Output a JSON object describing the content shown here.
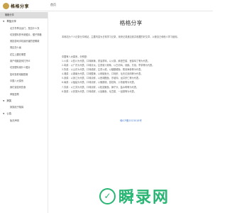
{
  "header": {
    "logo_text": "格格分享",
    "nav_home": "首页"
  },
  "sidebar": {
    "items": [
      {
        "kind": "item",
        "label": "格格分享",
        "active": true
      },
      {
        "kind": "group",
        "label": "草篮分享",
        "caret": "▼"
      },
      {
        "kind": "item",
        "label": "北方冬季出远门，是否什么衣"
      },
      {
        "kind": "item",
        "label": "切割塑料的专用锯片，锯子规格"
      },
      {
        "kind": "item",
        "label": "竞技游戏手机最厉害的是哪款"
      },
      {
        "kind": "item",
        "label": "周边怎么画"
      },
      {
        "kind": "item",
        "label": "花生上腰在哪里"
      },
      {
        "kind": "item",
        "label": "用户电脑如何打开IE"
      },
      {
        "kind": "item",
        "label": "切割塑料用什么锯片"
      },
      {
        "kind": "item",
        "label": "如何查看电脑配置"
      },
      {
        "kind": "item",
        "label": "中国八大菜系"
      },
      {
        "kind": "item",
        "label": "我们该如何饮食"
      },
      {
        "kind": "item",
        "label": "养殖蓝莓"
      },
      {
        "kind": "group",
        "label": "搞笑",
        "caret": "▼"
      },
      {
        "kind": "item",
        "label": "搞笑段子集锦"
      },
      {
        "kind": "group",
        "label": "公告",
        "caret": "▼"
      },
      {
        "kind": "item",
        "label": "免责声明"
      }
    ]
  },
  "main": {
    "title": "格格分享",
    "intro": "本网站为个人记录分享网站，主要内容为日常学习记录，用来记录遇见到并收藏的好文章，以便自己和他人学习使用。",
    "section_heading": "中国有八大菜系，分别是：",
    "lines": [
      "1.川菜：以四川为代表，口味麻辣，重油重味，以火锅、麻婆豆腐、宫保鸡丁等为代表。",
      "2.粤菜：以广东为代表，口味清淡，注重原汁原味，以白切鸡、烧鹅、叉烧、早茶等为代表。",
      "3.鲁菜：以山东为代表，口味咸鲜，注重火候，以糖醋鲤鱼、葱烧海参等为代表。",
      "4.湘菜：以湖南为代表，口味酸辣，以剁椒鱼头、口味虾、毛氏红烧肉等为代表。",
      "5.浙菜：以浙江为代表，口味清鲜，以西湖醋鱼、东坡肉、龙井虾仁等为代表。",
      "6.闽菜：以福建为代表，口味清鲜，以佛跳墙、荔枝肉、沙茶面等为代表。",
      "7.苏菜：以江苏为代表，口味清鲜，以松鼠鳜鱼、狮子头、盐水鸭等为代表。",
      "8.徽菜：以安徽为代表，口味咸鲜，以臭鳜鱼、毛豆腐、一品锅等为代表。"
    ],
    "footer_link": "赣ICP备2023018号"
  },
  "watermark": {
    "icon_glyph": "✓",
    "text": "瞬录网"
  }
}
